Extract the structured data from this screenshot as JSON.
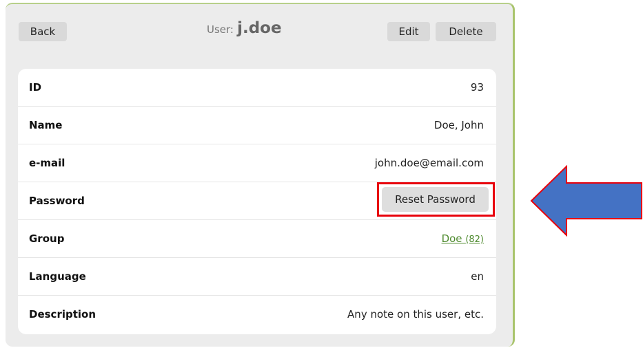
{
  "header": {
    "back_label": "Back",
    "title_prefix": "User:",
    "title_value": "j.doe",
    "edit_label": "Edit",
    "delete_label": "Delete"
  },
  "details": {
    "id": {
      "label": "ID",
      "value": "93"
    },
    "name": {
      "label": "Name",
      "value": "Doe, John"
    },
    "email": {
      "label": "e-mail",
      "value": "john.doe@email.com"
    },
    "password": {
      "label": "Password",
      "button": "Reset Password"
    },
    "group": {
      "label": "Group",
      "link_text": "Doe",
      "link_count": "(82)"
    },
    "language": {
      "label": "Language",
      "value": "en"
    },
    "description": {
      "label": "Description",
      "value": "Any note on this user, etc."
    }
  },
  "annotation": {
    "highlight_color": "#e8000b",
    "arrow_fill": "#4472c4",
    "arrow_stroke": "#e8000b"
  }
}
